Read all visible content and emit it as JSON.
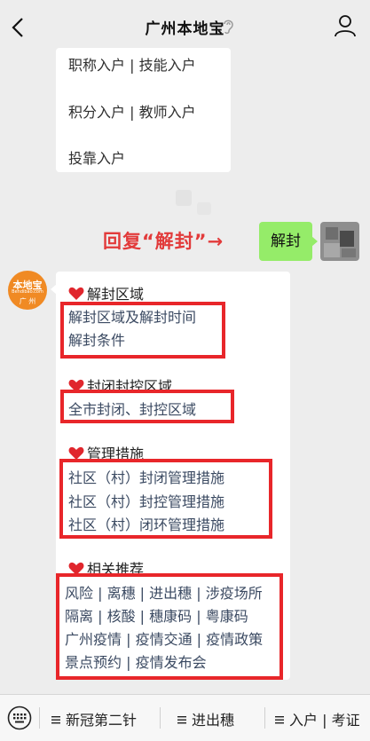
{
  "nav": {
    "title": "广州本地宝"
  },
  "prev_bubble": {
    "lines": [
      "职称入户 | 技能入户",
      "积分入户 | 教师入户",
      "投靠入户"
    ]
  },
  "reply": {
    "hint": "回复“解封”→",
    "user_message": "解封"
  },
  "bot_logo": {
    "line1": "本地宝",
    "line2": "Bendibao.com",
    "line3": "广 州"
  },
  "sections": [
    {
      "heading": "解封区域",
      "items": [
        "解封区域及解封时间",
        "解封条件"
      ]
    },
    {
      "heading": "封闭封控区域",
      "items": [
        "全市封闭、封控区域"
      ]
    },
    {
      "heading": "管理措施",
      "items": [
        "社区（村）封闭管理措施",
        "社区（村）封控管理措施",
        "社区（村）闭环管理措施"
      ]
    },
    {
      "heading": "相关推荐",
      "items": [
        "风险 | 离穗 | 进出穗 | 涉疫场所",
        "隔离 | 核酸 | 穗康码 | 粤康码",
        "广州疫情 | 疫情交通 | 疫情政策",
        "景点预约 | 疫情发布会"
      ]
    }
  ],
  "menu": [
    "新冠第二针",
    "进出穗",
    "入户 | 考证"
  ],
  "colors": {
    "highlight_box": "#e8262a",
    "reply_bubble": "#95ec69",
    "hint_text": "#e23a3a",
    "link_text": "#3b4a62"
  }
}
